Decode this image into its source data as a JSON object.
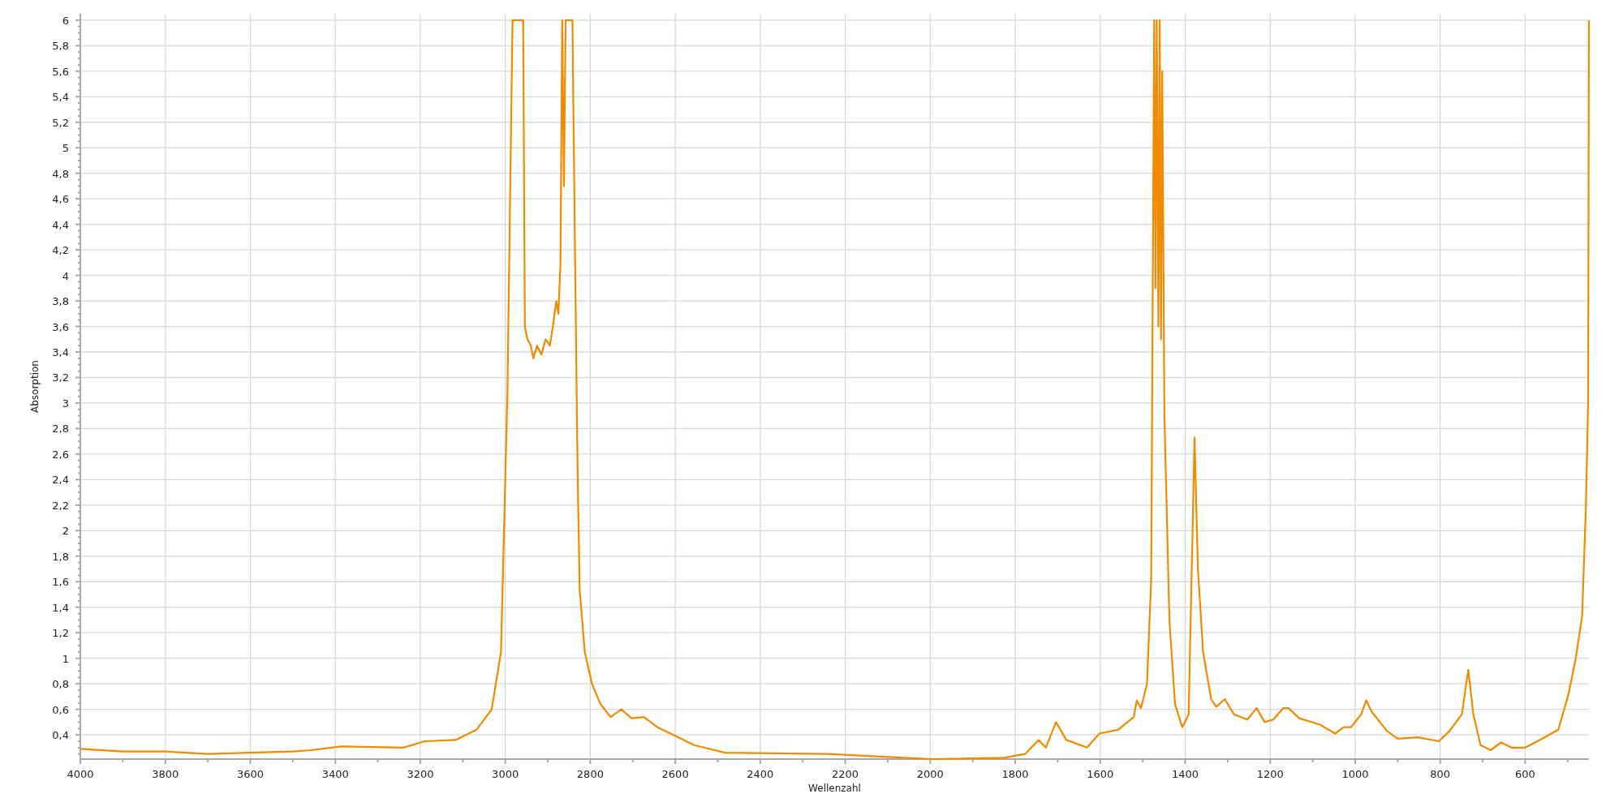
{
  "chart": {
    "chart_data": {
      "type": "line",
      "xlabel": "Wellenzahl",
      "ylabel": "Absorption",
      "x": [
        4000,
        3900,
        3800,
        3702,
        3600,
        3500,
        3458,
        3385,
        3239,
        3190,
        3117,
        3068,
        3032,
        3010,
        2995,
        2983,
        2958,
        2954,
        2948,
        2940,
        2934,
        2925,
        2915,
        2905,
        2895,
        2888,
        2880,
        2875,
        2870,
        2866,
        2862,
        2858,
        2842,
        2837,
        2830,
        2825,
        2813,
        2796,
        2776,
        2752,
        2727,
        2703,
        2674,
        2642,
        2605,
        2556,
        2483,
        2240,
        2118,
        1996,
        1826,
        1777,
        1745,
        1728,
        1704,
        1680,
        1631,
        1602,
        1558,
        1521,
        1514,
        1504,
        1490,
        1480,
        1473,
        1470,
        1467,
        1463,
        1460,
        1457,
        1454,
        1450,
        1449,
        1437,
        1424,
        1407,
        1392,
        1383,
        1378,
        1370,
        1358,
        1339,
        1327,
        1307,
        1285,
        1254,
        1232,
        1213,
        1193,
        1169,
        1157,
        1132,
        1083,
        1047,
        1027,
        1010,
        986,
        974,
        961,
        925,
        900,
        852,
        803,
        778,
        749,
        734,
        722,
        705,
        681,
        657,
        632,
        600,
        571,
        522,
        498,
        481,
        466,
        457,
        452,
        450
      ],
      "series": [
        {
          "color": "#f08a00",
          "values": [
            0.29,
            0.27,
            0.27,
            0.25,
            0.26,
            0.27,
            0.28,
            0.31,
            0.3,
            0.35,
            0.36,
            0.44,
            0.6,
            1.05,
            3.08,
            6,
            6,
            3.6,
            3.5,
            3.45,
            3.35,
            3.45,
            3.38,
            3.5,
            3.45,
            3.6,
            3.8,
            3.7,
            4.1,
            6,
            4.7,
            6,
            6,
            4.5,
            2.5,
            1.54,
            1.05,
            0.8,
            0.64,
            0.54,
            0.6,
            0.53,
            0.54,
            0.46,
            0.4,
            0.32,
            0.26,
            0.25,
            0.23,
            0.21,
            0.22,
            0.25,
            0.36,
            0.3,
            0.5,
            0.36,
            0.3,
            0.41,
            0.44,
            0.54,
            0.67,
            0.61,
            0.8,
            1.62,
            6,
            3.9,
            6,
            3.6,
            6,
            3.5,
            5.6,
            3.5,
            2.9,
            1.29,
            0.64,
            0.46,
            0.56,
            1.94,
            2.73,
            1.7,
            1.05,
            0.68,
            0.62,
            0.68,
            0.56,
            0.52,
            0.61,
            0.5,
            0.52,
            0.61,
            0.61,
            0.53,
            0.48,
            0.41,
            0.46,
            0.46,
            0.56,
            0.67,
            0.58,
            0.43,
            0.37,
            0.38,
            0.35,
            0.43,
            0.56,
            0.91,
            0.56,
            0.32,
            0.28,
            0.34,
            0.3,
            0.3,
            0.35,
            0.44,
            0.72,
            1.0,
            1.33,
            2.19,
            3.0,
            6.0
          ]
        }
      ],
      "grid": true,
      "xlim": [
        4000,
        450
      ],
      "ylim": [
        0.21,
        6.05
      ],
      "xticks": [
        4000,
        3800,
        3600,
        3400,
        3200,
        3000,
        2800,
        2600,
        2400,
        2200,
        2000,
        1800,
        1600,
        1400,
        1200,
        1000,
        800,
        600
      ],
      "yticks": [
        {
          "value": 0.4,
          "label": "0,4"
        },
        {
          "value": 0.6,
          "label": "0,6"
        },
        {
          "value": 0.8,
          "label": "0,8"
        },
        1,
        {
          "value": 1.2,
          "label": "1,2"
        },
        {
          "value": 1.4,
          "label": "1,4"
        },
        {
          "value": 1.6,
          "label": "1,6"
        },
        {
          "value": 1.8,
          "label": "1,8"
        },
        2,
        {
          "value": 2.2,
          "label": "2,2"
        },
        {
          "value": 2.4,
          "label": "2,4"
        },
        {
          "value": 2.6,
          "label": "2,6"
        },
        {
          "value": 2.8,
          "label": "2,8"
        },
        3,
        {
          "value": 3.2,
          "label": "3,2"
        },
        {
          "value": 3.4,
          "label": "3,4"
        },
        {
          "value": 3.6,
          "label": "3,6"
        },
        {
          "value": 3.8,
          "label": "3,8"
        },
        4,
        {
          "value": 4.2,
          "label": "4,2"
        },
        {
          "value": 4.4,
          "label": "4,4"
        },
        {
          "value": 4.6,
          "label": "4,6"
        },
        {
          "value": 4.8,
          "label": "4,8"
        },
        5,
        {
          "value": 5.2,
          "label": "5,2"
        },
        {
          "value": 5.4,
          "label": "5,4"
        },
        {
          "value": 5.6,
          "label": "5,6"
        },
        {
          "value": 5.8,
          "label": "5,8"
        },
        6
      ]
    }
  }
}
